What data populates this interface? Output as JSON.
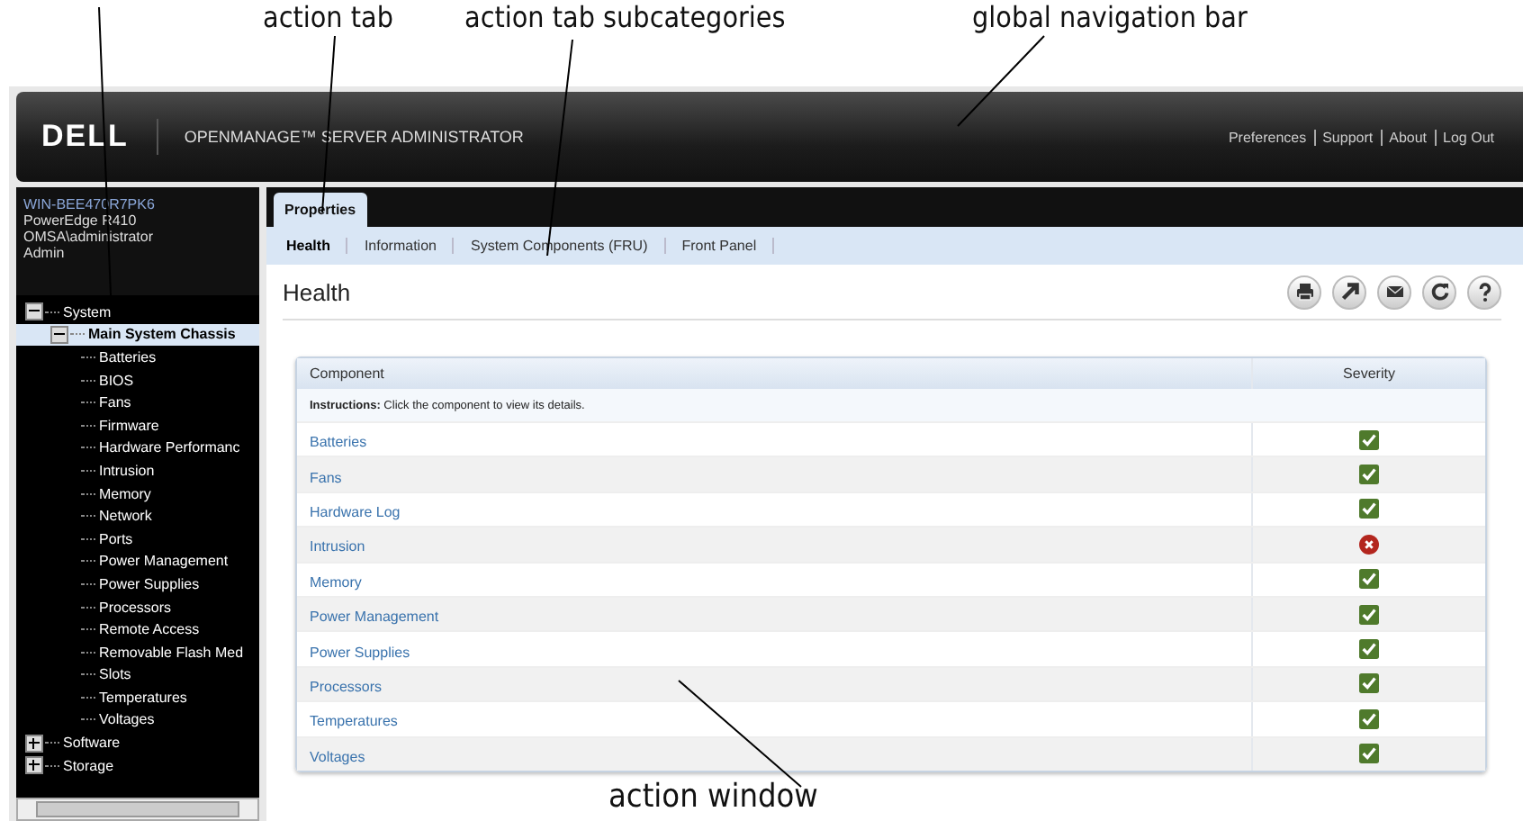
{
  "callouts": [
    {
      "text": "action tab"
    },
    {
      "text": "action tab subcategories"
    },
    {
      "text": "global navigation bar"
    },
    {
      "text": "action window"
    }
  ],
  "header": {
    "logo": "DELL",
    "product": "OPENMANAGE™ SERVER ADMINISTRATOR",
    "links": [
      "Preferences",
      "Support",
      "About",
      "Log Out"
    ]
  },
  "system_info": [
    "WIN-BEE470R7PK6",
    "PowerEdge R410",
    "OMSA\\administrator",
    "Admin"
  ],
  "tree": [
    {
      "label": "System",
      "expanded": true,
      "selected": false,
      "children": [
        {
          "label": "Main System Chassis",
          "expanded": true,
          "selected": true,
          "children": [
            {
              "label": "Batteries"
            },
            {
              "label": "BIOS"
            },
            {
              "label": "Fans"
            },
            {
              "label": "Firmware"
            },
            {
              "label": "Hardware Performanc"
            },
            {
              "label": "Intrusion"
            },
            {
              "label": "Memory"
            },
            {
              "label": "Network"
            },
            {
              "label": "Ports"
            },
            {
              "label": "Power Management"
            },
            {
              "label": "Power Supplies"
            },
            {
              "label": "Processors"
            },
            {
              "label": "Remote Access"
            },
            {
              "label": "Removable Flash Med"
            },
            {
              "label": "Slots"
            },
            {
              "label": "Temperatures"
            },
            {
              "label": "Voltages"
            }
          ]
        }
      ]
    },
    {
      "label": "Software",
      "expanded": false,
      "selected": false
    },
    {
      "label": "Storage",
      "expanded": false,
      "selected": false
    }
  ],
  "tabs": [
    {
      "label": "Properties",
      "selected": true
    }
  ],
  "subtabs": [
    {
      "label": "Health",
      "selected": true
    },
    {
      "label": "Information",
      "selected": false
    },
    {
      "label": "System Components (FRU)",
      "selected": false
    },
    {
      "label": "Front Panel",
      "selected": false
    }
  ],
  "page_title": "Health",
  "table": {
    "columns": [
      "Component",
      "Severity"
    ],
    "instructions": "**Instructions:** Click the component to view its details.",
    "rows": [
      {
        "component": "Batteries",
        "kind": "ok"
      },
      {
        "component": "Fans",
        "kind": "ok"
      },
      {
        "component": "Hardware Log",
        "kind": "ok"
      },
      {
        "component": "Intrusion",
        "kind": "critical"
      },
      {
        "component": "Memory",
        "kind": "ok"
      },
      {
        "component": "Power Management",
        "kind": "ok"
      },
      {
        "component": "Power Supplies",
        "kind": "ok"
      },
      {
        "component": "Processors",
        "kind": "ok"
      },
      {
        "component": "Temperatures",
        "kind": "ok"
      },
      {
        "component": "Voltages",
        "kind": "ok"
      }
    ]
  }
}
